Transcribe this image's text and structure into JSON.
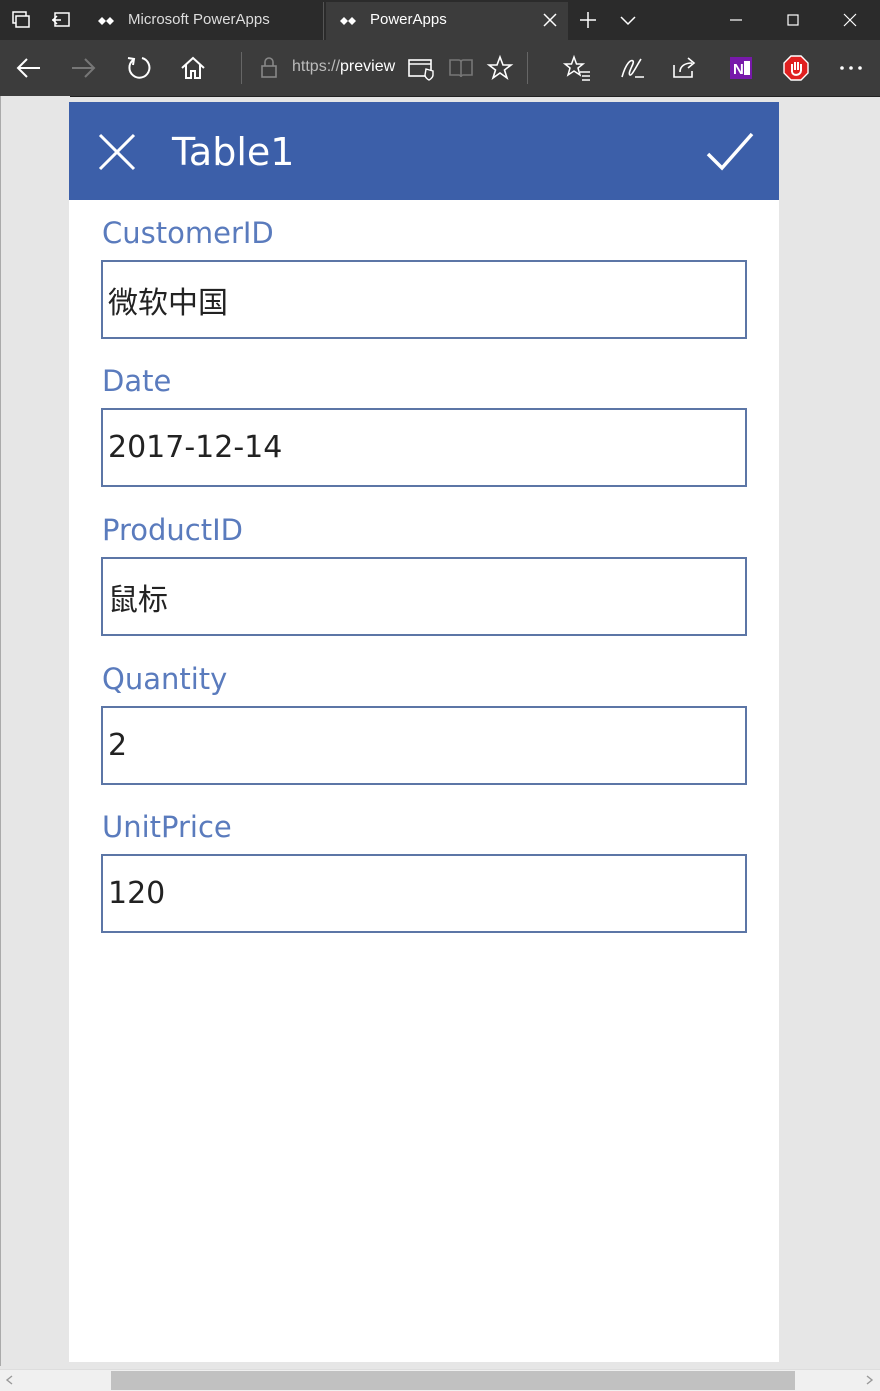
{
  "browser": {
    "tabs": [
      {
        "title": "Microsoft PowerApps",
        "favicon": "powerapps-logo-icon"
      },
      {
        "title": "PowerApps",
        "favicon": "powerapps-logo-icon"
      }
    ],
    "url_scheme": "https://",
    "url_host": "preview"
  },
  "form": {
    "title": "Table1",
    "fields": [
      {
        "label": "CustomerID",
        "value": "微软中国"
      },
      {
        "label": "Date",
        "value": "2017-12-14"
      },
      {
        "label": "ProductID",
        "value": "鼠标"
      },
      {
        "label": "Quantity",
        "value": "2"
      },
      {
        "label": "UnitPrice",
        "value": "120"
      }
    ]
  },
  "colors": {
    "header_bg": "#3c5fa9",
    "label_text": "#5a7bbd",
    "input_border": "#5c76a6",
    "browser_chrome": "#2b2b2b"
  }
}
